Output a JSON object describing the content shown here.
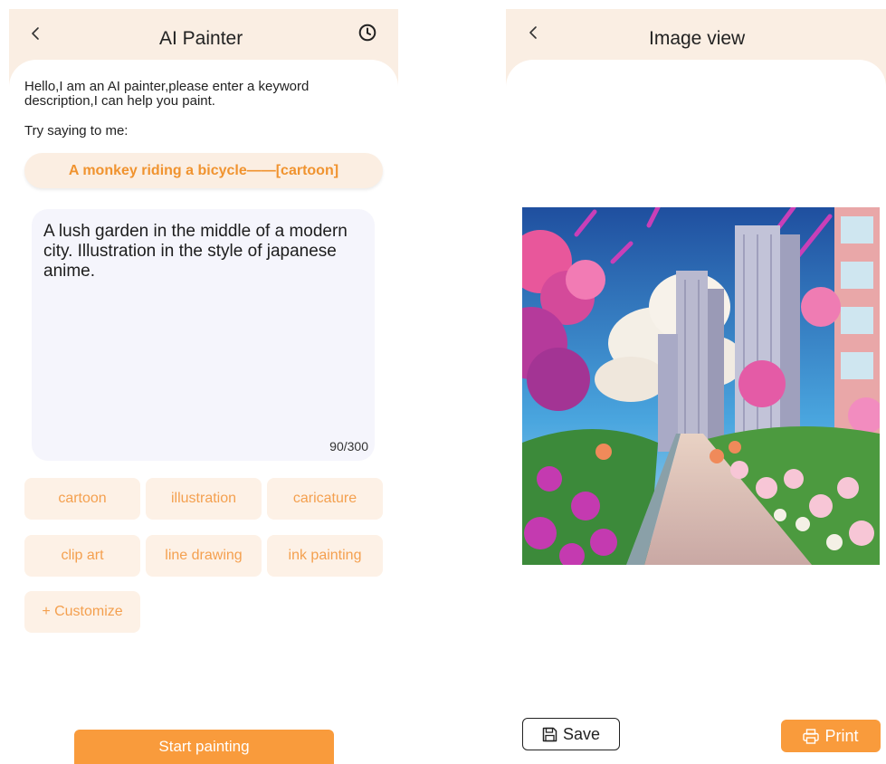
{
  "painter": {
    "title": "AI Painter",
    "intro": "Hello,I am an AI painter,please enter a keyword description,I can help you paint.",
    "try_label": "Try saying to me:",
    "suggestion": "A monkey riding a bicycle——[cartoon]",
    "prompt_text": "A lush garden in the middle of a modern city. Illustration in the style of japanese anime.",
    "char_count": "90/300",
    "styles": [
      "cartoon",
      "illustration",
      "caricature",
      "clip art",
      "line drawing",
      "ink painting"
    ],
    "customize_label": "+ Customize",
    "start_label": "Start painting",
    "icons": {
      "back": "back-chevron-icon",
      "history": "clock-icon"
    }
  },
  "image_view": {
    "title": "Image view",
    "save_label": "Save",
    "print_label": "Print",
    "icons": {
      "back": "back-chevron-icon",
      "save": "floppy-disk-icon",
      "print": "printer-icon"
    }
  },
  "colors": {
    "accent": "#f99b3c",
    "accent_text": "#f0932f",
    "chip_bg": "#fdf1e6",
    "chip_text": "#f4a04f",
    "header_bg": "#faeee3",
    "prompt_bg": "#f5f5fc"
  }
}
